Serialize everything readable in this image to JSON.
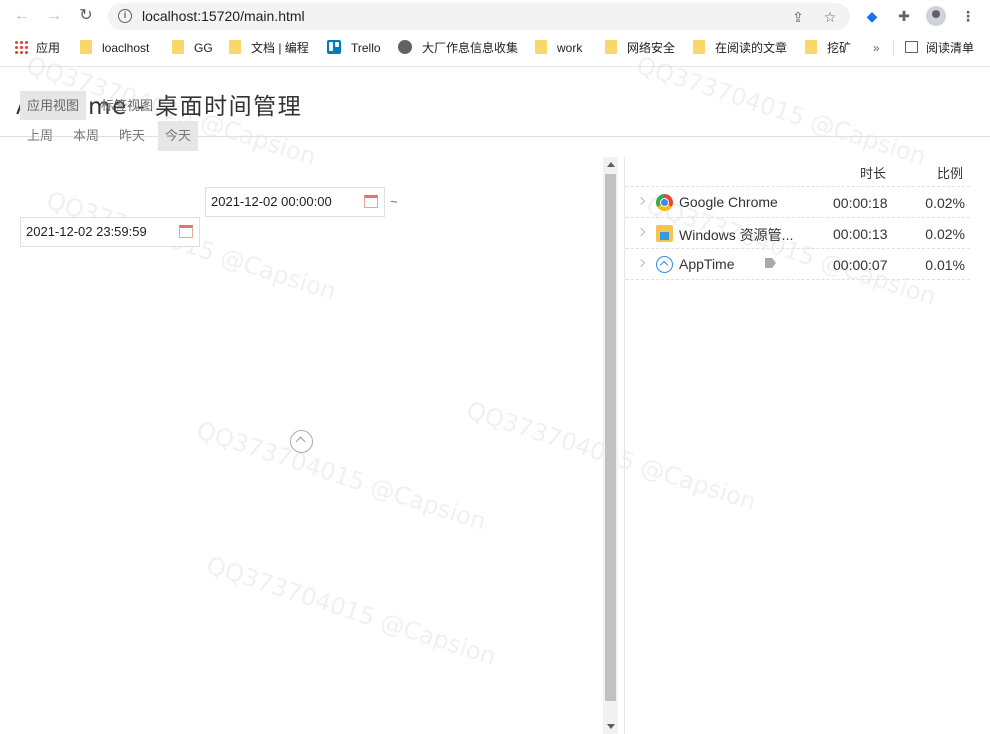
{
  "browser": {
    "url": "localhost:15720/main.html",
    "bookmarks": [
      {
        "label": "应用",
        "icon": "apps-grid-icon"
      },
      {
        "label": "loaclhost",
        "icon": "folder-icon"
      },
      {
        "label": "GG",
        "icon": "folder-icon"
      },
      {
        "label": "文档 | 编程",
        "icon": "folder-icon"
      },
      {
        "label": "Trello",
        "icon": "trello-icon"
      },
      {
        "label": "大厂作息信息收集",
        "icon": "globe-icon"
      },
      {
        "label": "work",
        "icon": "folder-icon"
      },
      {
        "label": "网络安全",
        "icon": "folder-icon"
      },
      {
        "label": "在阅读的文章",
        "icon": "folder-icon"
      },
      {
        "label": "挖矿",
        "icon": "folder-icon"
      }
    ],
    "overflow": "»",
    "reading_list": "阅读清单"
  },
  "app": {
    "title": "AppTime - 桌面时间管理",
    "view_tabs": [
      "应用视图",
      "标签视图"
    ],
    "active_view": "应用视图",
    "quick_ranges": [
      "上周",
      "本周",
      "昨天",
      "今天"
    ],
    "active_range": "今天",
    "start_time": "2021-12-02 00:00:00",
    "range_sep": "~",
    "end_time": "2021-12-02 23:59:59",
    "table": {
      "headers": {
        "duration": "时长",
        "ratio": "比例"
      },
      "rows": [
        {
          "name": "Google Chrome",
          "icon": "chrome-icon",
          "duration": "00:00:18",
          "ratio": "0.02%"
        },
        {
          "name": "Windows 资源管...",
          "icon": "file-explorer-icon",
          "duration": "00:00:13",
          "ratio": "0.02%"
        },
        {
          "name": "AppTime",
          "icon": "apptime-icon",
          "duration": "00:00:07",
          "ratio": "0.01%",
          "has_tag": true
        }
      ]
    }
  },
  "watermark": "QQ373704015 @Capsion"
}
